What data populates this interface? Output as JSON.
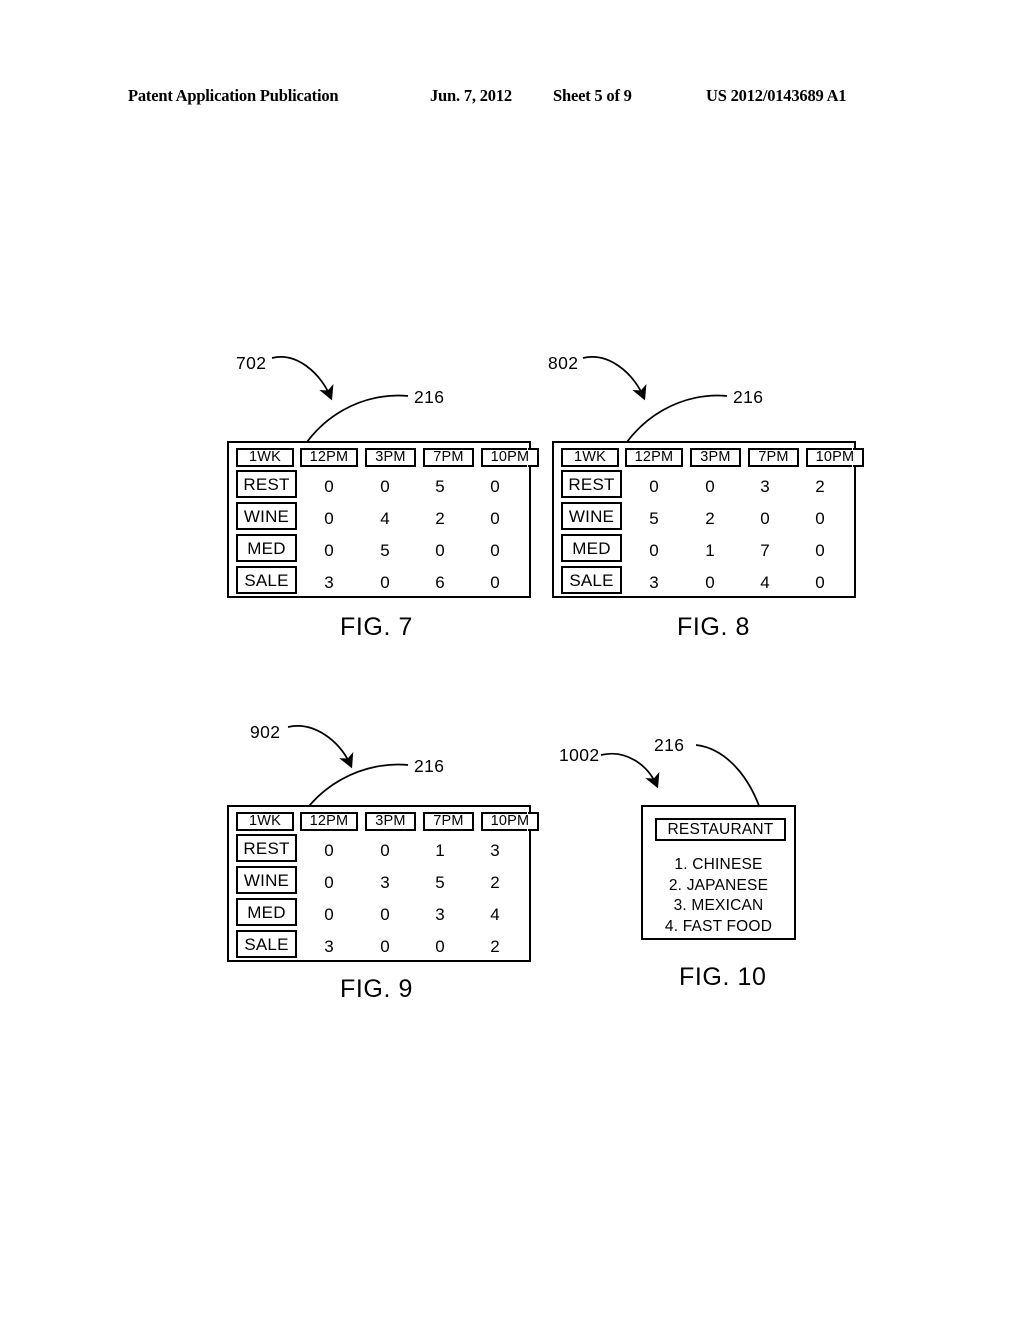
{
  "header": {
    "publication": "Patent Application Publication",
    "date": "Jun. 7, 2012",
    "sheet": "Sheet 5 of 9",
    "patent_number": "US 2012/0143689 A1"
  },
  "columns": [
    "1WK",
    "12PM",
    "3PM",
    "7PM",
    "10PM"
  ],
  "figures": [
    {
      "id": "fig7",
      "caption": "FIG. 7",
      "ref_figure": "702",
      "ref_element": "216",
      "columns": [
        "1WK",
        "12PM",
        "3PM",
        "7PM",
        "10PM"
      ],
      "rows": [
        {
          "label": "REST",
          "values": [
            "0",
            "0",
            "5",
            "0"
          ]
        },
        {
          "label": "WINE",
          "values": [
            "0",
            "4",
            "2",
            "0"
          ]
        },
        {
          "label": "MED",
          "values": [
            "0",
            "5",
            "0",
            "0"
          ]
        },
        {
          "label": "SALE",
          "values": [
            "3",
            "0",
            "6",
            "0"
          ]
        }
      ]
    },
    {
      "id": "fig8",
      "caption": "FIG. 8",
      "ref_figure": "802",
      "ref_element": "216",
      "columns": [
        "1WK",
        "12PM",
        "3PM",
        "7PM",
        "10PM"
      ],
      "rows": [
        {
          "label": "REST",
          "values": [
            "0",
            "0",
            "3",
            "2"
          ]
        },
        {
          "label": "WINE",
          "values": [
            "5",
            "2",
            "0",
            "0"
          ]
        },
        {
          "label": "MED",
          "values": [
            "0",
            "1",
            "7",
            "0"
          ]
        },
        {
          "label": "SALE",
          "values": [
            "3",
            "0",
            "4",
            "0"
          ]
        }
      ]
    },
    {
      "id": "fig9",
      "caption": "FIG. 9",
      "ref_figure": "902",
      "ref_element": "216",
      "columns": [
        "1WK",
        "12PM",
        "3PM",
        "7PM",
        "10PM"
      ],
      "rows": [
        {
          "label": "REST",
          "values": [
            "0",
            "0",
            "1",
            "3"
          ]
        },
        {
          "label": "WINE",
          "values": [
            "0",
            "3",
            "5",
            "2"
          ]
        },
        {
          "label": "MED",
          "values": [
            "0",
            "0",
            "3",
            "4"
          ]
        },
        {
          "label": "SALE",
          "values": [
            "3",
            "0",
            "0",
            "2"
          ]
        }
      ]
    }
  ],
  "fig10": {
    "caption": "FIG. 10",
    "ref_figure": "1002",
    "ref_element": "216",
    "title": "RESTAURANT",
    "items": [
      "1. CHINESE",
      "2. JAPANESE",
      "3. MEXICAN",
      "4. FAST FOOD"
    ]
  },
  "chart_data": {
    "type": "table",
    "title": "Usage counts by category and time slot",
    "columns": [
      "1WK",
      "12PM",
      "3PM",
      "7PM",
      "10PM"
    ],
    "tables": [
      {
        "name": "FIG. 7",
        "categories": [
          "REST",
          "WINE",
          "MED",
          "SALE"
        ],
        "series": [
          {
            "name": "12PM",
            "values": [
              0,
              0,
              0,
              3
            ]
          },
          {
            "name": "3PM",
            "values": [
              0,
              4,
              5,
              0
            ]
          },
          {
            "name": "7PM",
            "values": [
              5,
              2,
              0,
              6
            ]
          },
          {
            "name": "10PM",
            "values": [
              0,
              0,
              0,
              0
            ]
          }
        ]
      },
      {
        "name": "FIG. 8",
        "categories": [
          "REST",
          "WINE",
          "MED",
          "SALE"
        ],
        "series": [
          {
            "name": "12PM",
            "values": [
              0,
              5,
              0,
              3
            ]
          },
          {
            "name": "3PM",
            "values": [
              0,
              2,
              1,
              0
            ]
          },
          {
            "name": "7PM",
            "values": [
              3,
              0,
              7,
              4
            ]
          },
          {
            "name": "10PM",
            "values": [
              2,
              0,
              0,
              0
            ]
          }
        ]
      },
      {
        "name": "FIG. 9",
        "categories": [
          "REST",
          "WINE",
          "MED",
          "SALE"
        ],
        "series": [
          {
            "name": "12PM",
            "values": [
              0,
              0,
              0,
              3
            ]
          },
          {
            "name": "3PM",
            "values": [
              0,
              3,
              0,
              0
            ]
          },
          {
            "name": "7PM",
            "values": [
              1,
              5,
              3,
              0
            ]
          },
          {
            "name": "10PM",
            "values": [
              3,
              2,
              4,
              2
            ]
          }
        ]
      }
    ]
  }
}
